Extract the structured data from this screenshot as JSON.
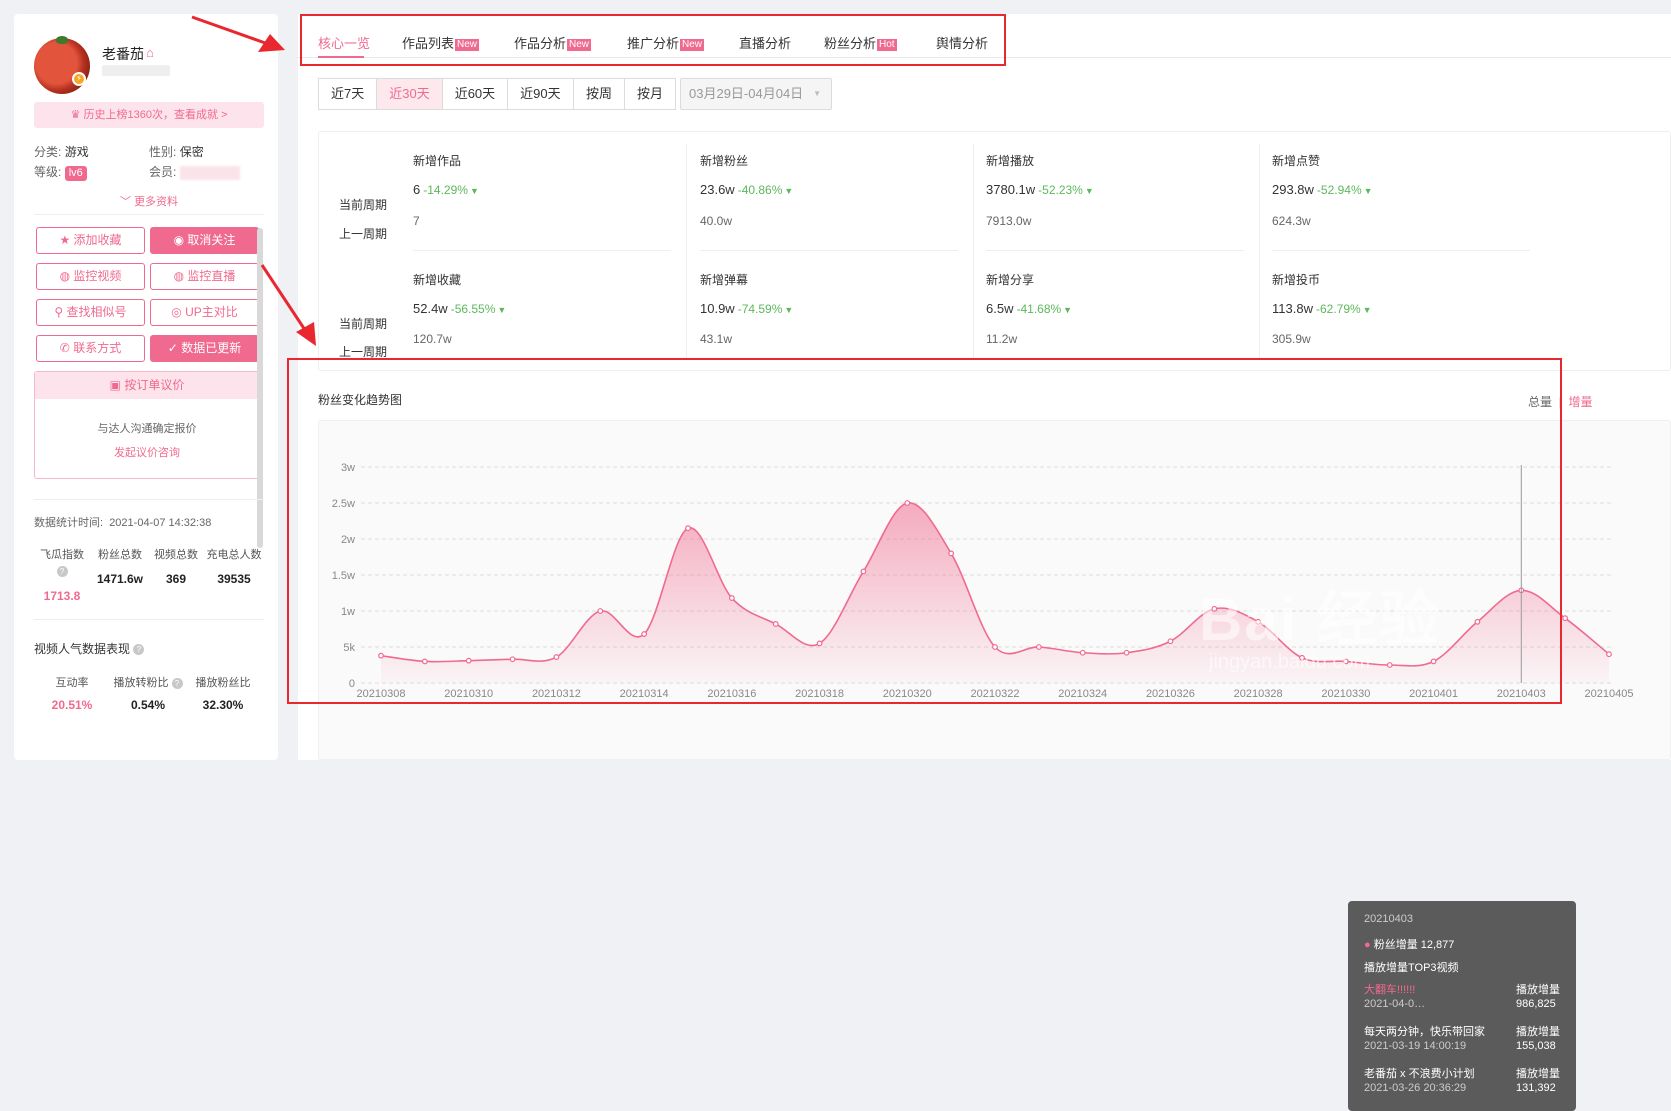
{
  "profile": {
    "name": "老番茄",
    "honor": "历史上榜1360次，查看成就 >",
    "category_label": "分类:",
    "category": "游戏",
    "gender_label": "性别:",
    "gender": "保密",
    "level_label": "等级:",
    "level": "lv6",
    "member_label": "会员:",
    "more": "更多资料"
  },
  "actions": {
    "favorite": "添加收藏",
    "unfollow": "取消关注",
    "monitor_video": "监控视频",
    "monitor_live": "监控直播",
    "find_similar": "查找相似号",
    "compare": "UP主对比",
    "contact": "联系方式",
    "updated": "数据已更新"
  },
  "quote": {
    "title": "按订单议价",
    "desc": "与达人沟通确定报价",
    "link": "发起议价咨询"
  },
  "stats": {
    "time_label": "数据统计时间:",
    "time": "2021-04-07 14:32:38",
    "items": [
      {
        "label": "飞瓜指数",
        "value": "1713.8"
      },
      {
        "label": "粉丝总数",
        "value": "1471.6w"
      },
      {
        "label": "视频总数",
        "value": "369"
      },
      {
        "label": "充电总人数",
        "value": "39535"
      }
    ]
  },
  "video_perf": {
    "title": "视频人气数据表现",
    "items": [
      {
        "label": "互动率",
        "value": "20.51%"
      },
      {
        "label": "播放转粉比",
        "value": "0.54%"
      },
      {
        "label": "播放粉丝比",
        "value": "32.30%"
      }
    ]
  },
  "tabs": [
    {
      "label": "核心一览",
      "tag": ""
    },
    {
      "label": "作品列表",
      "tag": "New"
    },
    {
      "label": "作品分析",
      "tag": "New"
    },
    {
      "label": "推广分析",
      "tag": "New"
    },
    {
      "label": "直播分析",
      "tag": ""
    },
    {
      "label": "粉丝分析",
      "tag": "Hot"
    },
    {
      "label": "舆情分析",
      "tag": ""
    }
  ],
  "range": {
    "days": [
      "近7天",
      "近30天",
      "近60天",
      "近90天"
    ],
    "period": [
      "按周",
      "按月"
    ],
    "date": "03月29日-04月04日"
  },
  "metrics": {
    "cur_label": "当前周期",
    "prev_label": "上一周期",
    "items": [
      {
        "name": "新增作品",
        "cur": "6",
        "pct": "-14.29%",
        "prev": "7"
      },
      {
        "name": "新增粉丝",
        "cur": "23.6w",
        "pct": "-40.86%",
        "prev": "40.0w"
      },
      {
        "name": "新增播放",
        "cur": "3780.1w",
        "pct": "-52.23%",
        "prev": "7913.0w"
      },
      {
        "name": "新增点赞",
        "cur": "293.8w",
        "pct": "-52.94%",
        "prev": "624.3w"
      },
      {
        "name": "新增收藏",
        "cur": "52.4w",
        "pct": "-56.55%",
        "prev": "120.7w"
      },
      {
        "name": "新增弹幕",
        "cur": "10.9w",
        "pct": "-74.59%",
        "prev": "43.1w"
      },
      {
        "name": "新增分享",
        "cur": "6.5w",
        "pct": "-41.68%",
        "prev": "11.2w"
      },
      {
        "name": "新增投币",
        "cur": "113.8w",
        "pct": "-62.79%",
        "prev": "305.9w"
      }
    ]
  },
  "chart": {
    "title": "粉丝变化趋势图",
    "toggle_total": "总量",
    "toggle_sep": "|",
    "toggle_incr": "增量"
  },
  "chart_data": {
    "type": "area",
    "title": "粉丝变化趋势图",
    "xlabel": "",
    "ylabel": "",
    "ylim": [
      0,
      30000
    ],
    "yticks": [
      "0",
      "5k",
      "1w",
      "1.5w",
      "2w",
      "2.5w",
      "3w"
    ],
    "x": [
      "20210308",
      "20210309",
      "20210310",
      "20210311",
      "20210312",
      "20210313",
      "20210314",
      "20210315",
      "20210316",
      "20210317",
      "20210318",
      "20210319",
      "20210320",
      "20210321",
      "20210322",
      "20210323",
      "20210324",
      "20210325",
      "20210326",
      "20210327",
      "20210328",
      "20210329",
      "20210330",
      "20210331",
      "20210401",
      "20210402",
      "20210403",
      "20210404",
      "20210405"
    ],
    "xticks": [
      "20210308",
      "20210310",
      "20210312",
      "20210314",
      "20210316",
      "20210318",
      "20210320",
      "20210322",
      "20210324",
      "20210326",
      "20210328",
      "20210330",
      "20210401",
      "20210403",
      "20210405"
    ],
    "series": [
      {
        "name": "粉丝增量",
        "color": "#f06a8f",
        "values": [
          3800,
          3000,
          3100,
          3300,
          3600,
          10000,
          6800,
          21500,
          11800,
          8200,
          5500,
          15500,
          25000,
          18000,
          5000,
          5000,
          4200,
          4200,
          5800,
          10300,
          8500,
          3500,
          3000,
          2500,
          3000,
          8500,
          12877,
          9000,
          4000
        ]
      }
    ]
  },
  "tooltip": {
    "date": "20210403",
    "series": "粉丝增量 12,877",
    "top_title": "播放增量TOP3视频",
    "rows": [
      {
        "title": "大翻车!!!!!!",
        "time": "2021-04-0…",
        "label": "播放增量",
        "value": "986,825"
      },
      {
        "title": "每天两分钟，快乐带回家",
        "time": "2021-03-19 14:00:19",
        "label": "播放增量",
        "value": "155,038"
      },
      {
        "title": "老番茄 x 不浪费小计划",
        "time": "2021-03-26 20:36:29",
        "label": "播放增量",
        "value": "131,392"
      }
    ]
  },
  "watermark": {
    "main": "Bai 经验",
    "sub": "jingyan.baidu.com"
  },
  "colors": {
    "accent": "#f06a8f",
    "annotation": "#e8282e",
    "down": "#5cb85c"
  }
}
